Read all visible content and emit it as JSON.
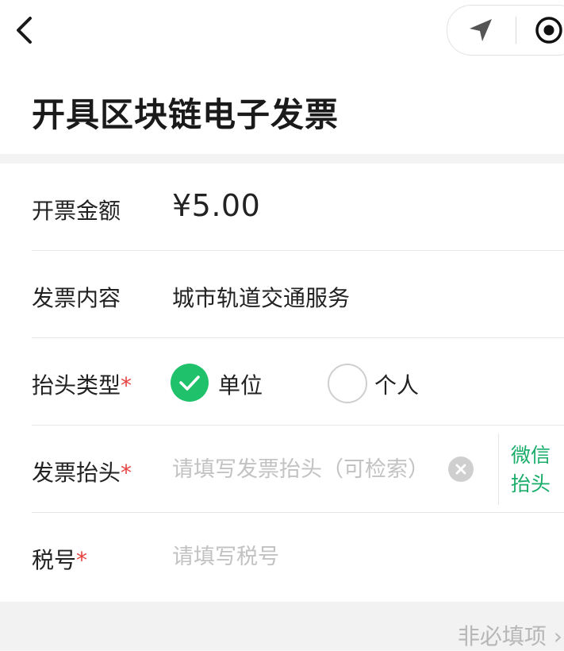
{
  "nav": {
    "back_icon": "chevron-left-icon",
    "capsule_icons": [
      "location-arrow-icon",
      "record-circle-icon"
    ]
  },
  "page": {
    "title": "开具区块链电子发票"
  },
  "form": {
    "amount": {
      "label": "开票金额",
      "value": "¥5.00"
    },
    "content": {
      "label": "发票内容",
      "value": "城市轨道交通服务"
    },
    "title_type": {
      "label": "抬头类型",
      "required_mark": "*",
      "options": [
        {
          "label": "单位",
          "selected": true
        },
        {
          "label": "个人",
          "selected": false
        }
      ]
    },
    "invoice_title": {
      "label": "发票抬头",
      "required_mark": "*",
      "placeholder": "请填写发票抬头（可检索）",
      "wechat_link": "微信抬头"
    },
    "tax_id": {
      "label": "税号",
      "required_mark": "*",
      "placeholder": "请填写税号"
    }
  },
  "footer": {
    "optional_label": "非必填项 ›"
  },
  "colors": {
    "accent_green": "#1fc16a",
    "required_red": "#e64340",
    "link_green": "#1aad6a"
  }
}
